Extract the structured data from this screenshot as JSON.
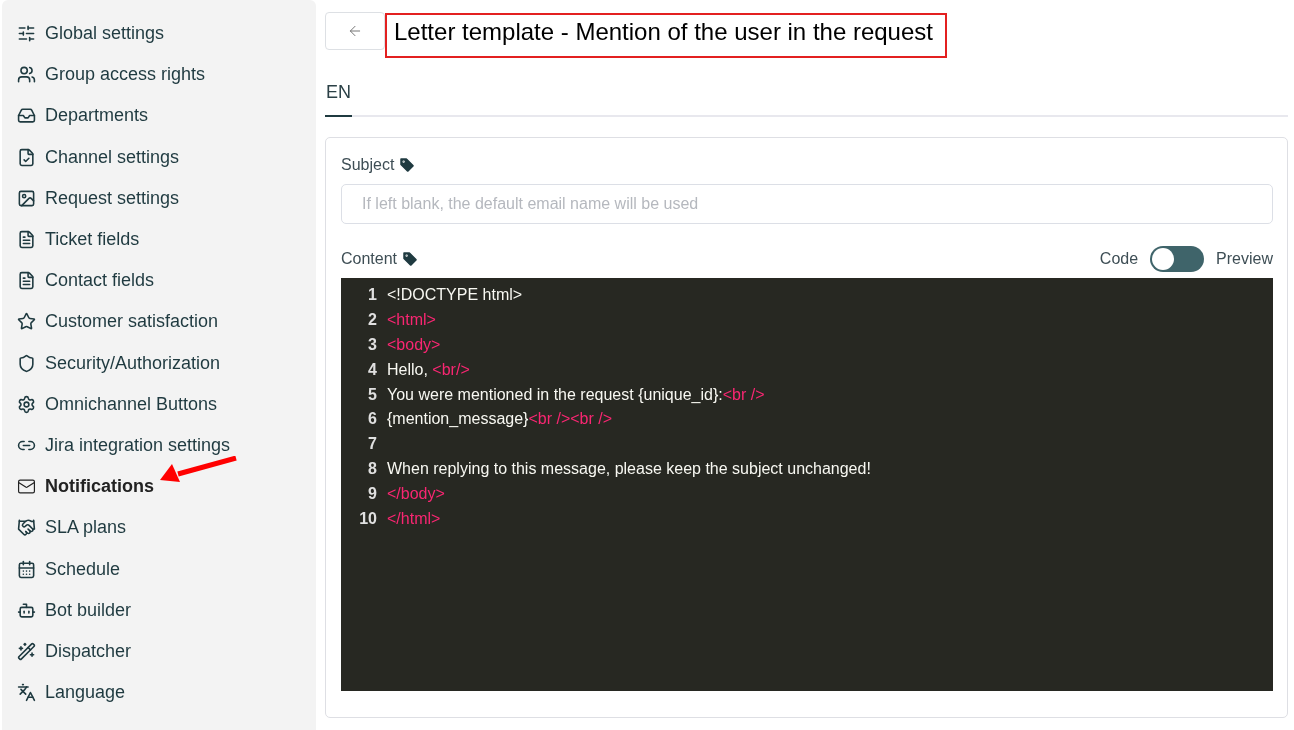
{
  "sidebar": {
    "items": [
      {
        "label": "Global settings",
        "selected": false
      },
      {
        "label": "Group access rights",
        "selected": false
      },
      {
        "label": "Departments",
        "selected": false
      },
      {
        "label": "Channel settings",
        "selected": false
      },
      {
        "label": "Request settings",
        "selected": false
      },
      {
        "label": "Ticket fields",
        "selected": false
      },
      {
        "label": "Contact fields",
        "selected": false
      },
      {
        "label": "Customer satisfaction",
        "selected": false
      },
      {
        "label": "Security/Authorization",
        "selected": false
      },
      {
        "label": "Omnichannel Buttons",
        "selected": false
      },
      {
        "label": "Jira integration settings",
        "selected": false
      },
      {
        "label": "Notifications",
        "selected": true
      },
      {
        "label": "SLA plans",
        "selected": false
      },
      {
        "label": "Schedule",
        "selected": false
      },
      {
        "label": "Bot builder",
        "selected": false
      },
      {
        "label": "Dispatcher",
        "selected": false
      },
      {
        "label": "Language",
        "selected": false
      }
    ]
  },
  "header": {
    "title": "Letter template - Mention of the user in the request"
  },
  "tabs": [
    {
      "label": "EN",
      "selected": true
    }
  ],
  "form": {
    "subject": {
      "label": "Subject",
      "placeholder": "If left blank, the default email name will be used"
    },
    "content": {
      "label": "Content",
      "toggle": {
        "left": "Code",
        "right": "Preview",
        "on": false
      },
      "lines": [
        {
          "number": "1",
          "parts": [
            {
              "kind": "text",
              "text": "<!DOCTYPE html>"
            }
          ]
        },
        {
          "number": "2",
          "parts": [
            {
              "kind": "tag",
              "text": "<html>"
            }
          ]
        },
        {
          "number": "3",
          "parts": [
            {
              "kind": "tag",
              "text": "<body>"
            }
          ]
        },
        {
          "number": "4",
          "parts": [
            {
              "kind": "text",
              "text": "Hello, "
            },
            {
              "kind": "tag",
              "text": "<br/>"
            }
          ]
        },
        {
          "number": "5",
          "parts": [
            {
              "kind": "text",
              "text": "You were mentioned in the request {unique_id}:"
            },
            {
              "kind": "tag",
              "text": "<br />"
            }
          ]
        },
        {
          "number": "6",
          "parts": [
            {
              "kind": "text",
              "text": "{mention_message}"
            },
            {
              "kind": "tag",
              "text": "<br /><br />"
            }
          ]
        },
        {
          "number": "7"
        },
        {
          "number": "8",
          "parts": [
            {
              "kind": "text",
              "text": "When replying to this message, please keep the subject unchanged!"
            }
          ]
        },
        {
          "number": "9",
          "parts": [
            {
              "kind": "tag",
              "text": "</body>"
            }
          ]
        },
        {
          "number": "10",
          "parts": [
            {
              "kind": "tag",
              "text": "</html>"
            }
          ]
        }
      ]
    }
  }
}
